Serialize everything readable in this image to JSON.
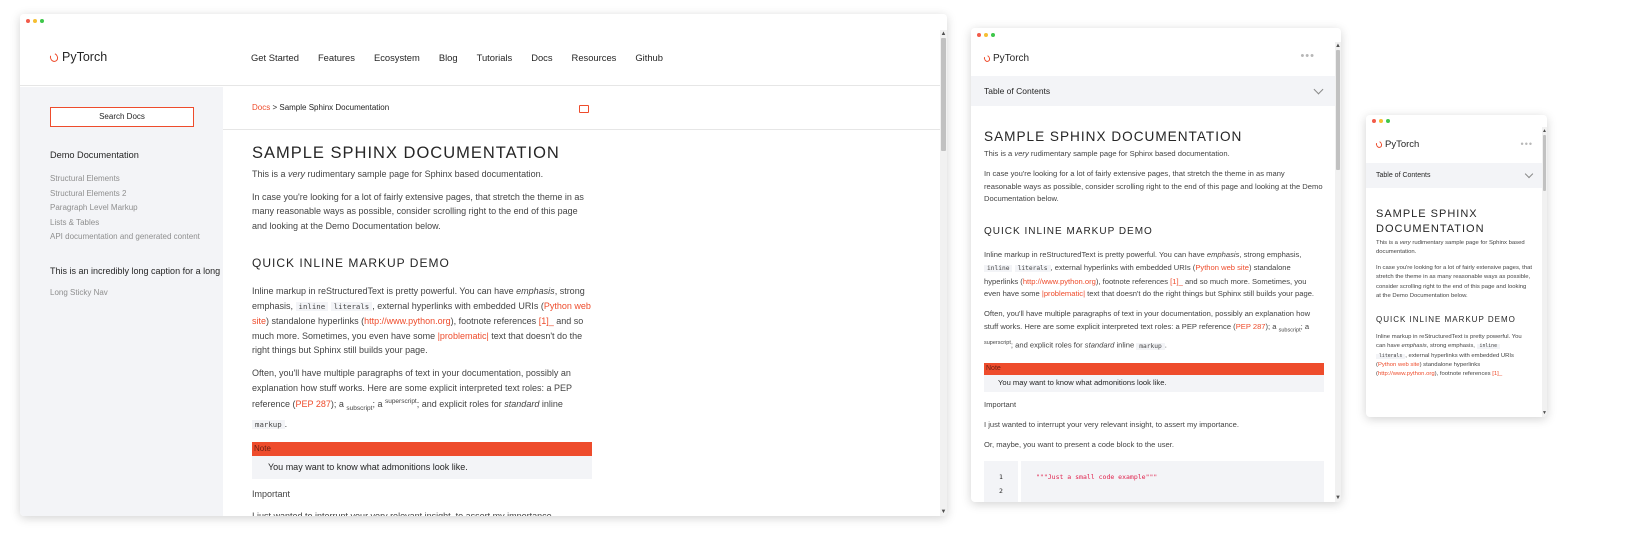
{
  "brand": {
    "name": "PyTorch",
    "accent": "#ee4c2c"
  },
  "nav": [
    "Get Started",
    "Features",
    "Ecosystem",
    "Blog",
    "Tutorials",
    "Docs",
    "Resources",
    "Github"
  ],
  "sidebar": {
    "search_label": "Search Docs",
    "section_title": "Demo Documentation",
    "items": [
      "Structural Elements",
      "Structural Elements 2",
      "Paragraph Level Markup",
      "Lists & Tables",
      "API documentation and generated content"
    ],
    "caption": "This is an incredibly long caption for a long m",
    "sticky": "Long Sticky Nav"
  },
  "breadcrumb": {
    "root": "Docs",
    "sep": " > ",
    "current": "Sample Sphinx Documentation"
  },
  "toc_label": "Table of Contents",
  "content": {
    "title": "SAMPLE SPHINX DOCUMENTATION",
    "intro_pre": "This is a ",
    "intro_em": "very",
    "intro_post": " rudimentary sample page for Sphinx based documentation.",
    "para2": "In case you're looking for a lot of fairly extensive pages, that stretch the theme in as many reasonable ways as possible, consider scrolling right to the end of this page and looking at the Demo Documentation below.",
    "h2": "QUICK INLINE MARKUP DEMO",
    "p3_a": "Inline markup in reStructuredText is pretty powerful. You can have ",
    "p3_em": "emphasis",
    "p3_b": ", strong emphasis, ",
    "code_inline": "inline",
    "code_literals": "literals",
    "p3_c": ", external hyperlinks with embedded URIs (",
    "link_python_web": "Python web site",
    "p3_d": ") standalone hyperlinks (",
    "link_python_org": "http://www.python.org",
    "p3_e": "), footnote references ",
    "link_footnote": "[1]_",
    "p3_f": " and so much more. Sometimes, you even have some ",
    "link_problematic": "|problematic|",
    "p3_g": " text that doesn't do the right things but Sphinx still builds your page.",
    "p4_a": "Often, you'll have multiple paragraphs of text in your documentation, possibly an explanation how stuff works. Here are some explicit interpreted text roles: a PEP reference (",
    "link_pep": "PEP 287",
    "p4_b": "); a ",
    "sub": "subscript",
    "p4_c": "; a ",
    "sup": "superscript",
    "p4_d": "; and explicit roles for ",
    "p4_em": "standard",
    "p4_e": " inline ",
    "code_markup": "markup",
    "p4_f": ".",
    "note_title": "Note",
    "note_body": "You may want to know what admonitions look like.",
    "important": "Important",
    "important_body": "I just wanted to interrupt your very relevant insight, to assert my importance.",
    "code_intro": "Or, maybe, you want to present a code block to the user.",
    "code_line1": "\"\"\"Just a small code example\"\"\"",
    "line_nums": [
      "1",
      "2"
    ]
  }
}
